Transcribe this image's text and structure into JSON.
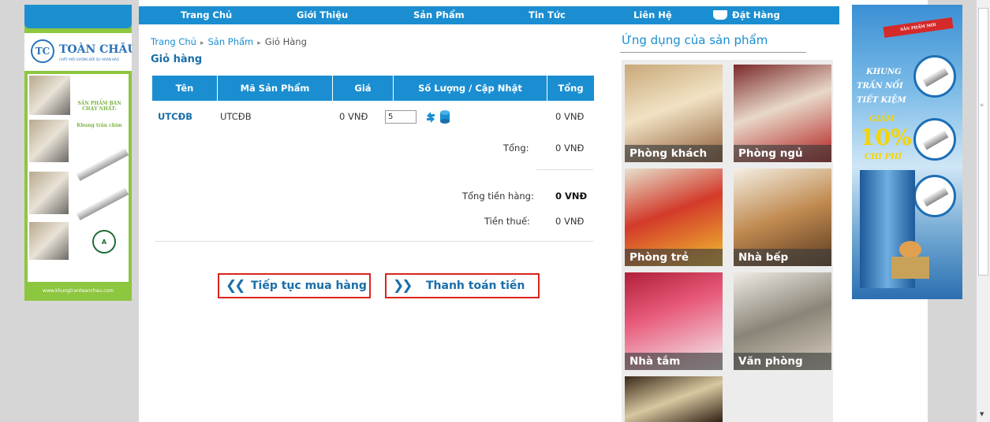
{
  "nav": {
    "items": [
      "Trang Chủ",
      "Giới Thiệu",
      "Sản Phẩm",
      "Tin Tức",
      "Liên Hệ",
      "Đặt Hàng"
    ]
  },
  "breadcrumb": {
    "home": "Trang Chủ",
    "products": "Sản Phẩm",
    "current": "Giỏ Hàng"
  },
  "cart": {
    "heading": "Giỏ hàng",
    "columns": [
      "Tên",
      "Mã Sản Phẩm",
      "Giá",
      "Số Lượng / Cập Nhật",
      "Tổng"
    ],
    "rows": [
      {
        "name": "UTCĐB",
        "code": "UTCĐB",
        "price": "0 VNĐ",
        "quantity": "5",
        "total": "0 VNĐ"
      }
    ],
    "subtotal_label": "Tổng:",
    "subtotal_value": "0 VNĐ",
    "grand_total_label": "Tổng tiền hàng:",
    "grand_total_value": "0 VNĐ",
    "tax_label": "Tiền thuế:",
    "tax_value": "0 VNĐ",
    "continue_button": "Tiếp tục mua hàng",
    "checkout_button": "Thanh toán tiền"
  },
  "applications": {
    "title": "Ứng dụng của sản phẩm",
    "tiles": [
      "Phòng khách",
      "Phòng ngủ",
      "Phòng trẻ",
      "Nhà bếp",
      "Nhà tắm",
      "Văn phòng"
    ]
  },
  "left_banner": {
    "brand": "TOÀN CHÂU",
    "brand_sub": "CHẤT MỚI VUÔNG ĐỒI SỰ HOÀN HẢO",
    "promo": "SẢN PHẨM BÁN CHẠY NHẤT:",
    "promo_item": "Khung trần chìm",
    "website": "www.khungtranteanchau.com"
  },
  "right_banner": {
    "ribbon": "SẢN PHẨM MỚI",
    "line1": "KHUNG",
    "line2": "TRẦN NỔI",
    "line3": "TIẾT KIỆM",
    "discount_label": "GIẢM",
    "discount_value": "10%",
    "discount_sub": "CHI PHÍ"
  },
  "colors": {
    "nav_blue": "#1a8ed1",
    "button_border": "#d9251d",
    "banner_green": "#8dc63f"
  }
}
